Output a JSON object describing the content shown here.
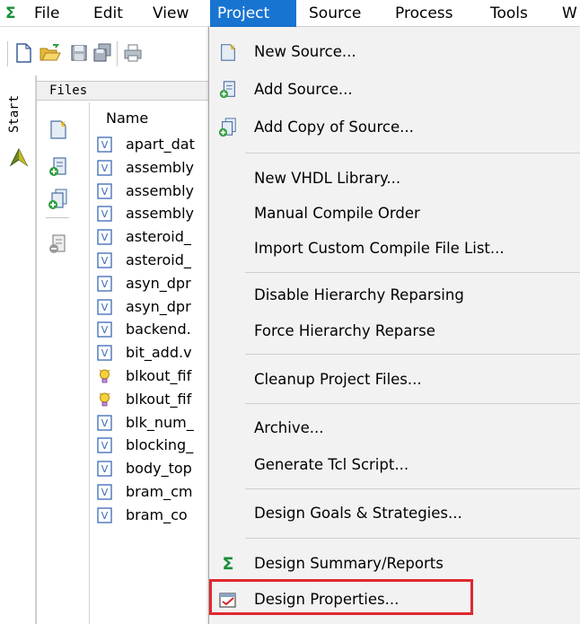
{
  "menubar": {
    "items": [
      {
        "label": "File"
      },
      {
        "label": "Edit"
      },
      {
        "label": "View"
      },
      {
        "label": "Project"
      },
      {
        "label": "Source"
      },
      {
        "label": "Process"
      },
      {
        "label": "Tools"
      },
      {
        "label": "W"
      }
    ],
    "active_item": "Project",
    "logo_glyph": "Σ"
  },
  "toolbar": {
    "icons": [
      "new-file-icon",
      "open-folder-icon",
      "save-icon",
      "save-all-icon",
      "print-icon"
    ]
  },
  "start_panel": {
    "tab_label": "Start"
  },
  "files_panel": {
    "header": "Files",
    "column_header": "Name",
    "side_icons": [
      "new-source-icon",
      "add-source-icon",
      "add-copy-source-icon",
      "remove-icon"
    ],
    "files": [
      {
        "name": "apart_dat",
        "icon": "verilog-file-icon"
      },
      {
        "name": "assembly",
        "icon": "verilog-file-icon"
      },
      {
        "name": "assembly",
        "icon": "verilog-file-icon"
      },
      {
        "name": "assembly",
        "icon": "verilog-file-icon"
      },
      {
        "name": "asteroid_",
        "icon": "verilog-file-icon"
      },
      {
        "name": "asteroid_",
        "icon": "verilog-file-icon"
      },
      {
        "name": "asyn_dpr",
        "icon": "verilog-file-icon"
      },
      {
        "name": "asyn_dpr",
        "icon": "verilog-file-icon"
      },
      {
        "name": "backend.",
        "icon": "verilog-file-icon"
      },
      {
        "name": "bit_add.v",
        "icon": "verilog-file-icon"
      },
      {
        "name": "blkout_fif",
        "icon": "ip-core-icon"
      },
      {
        "name": "blkout_fif",
        "icon": "ip-core-icon"
      },
      {
        "name": "blk_num_",
        "icon": "verilog-file-icon"
      },
      {
        "name": "blocking_",
        "icon": "verilog-file-icon"
      },
      {
        "name": "body_top",
        "icon": "verilog-file-icon"
      },
      {
        "name": "bram_cm",
        "icon": "verilog-file-icon"
      },
      {
        "name": "bram_co",
        "icon": "verilog-file-icon"
      }
    ]
  },
  "project_menu": {
    "items": [
      {
        "label": "New Source...",
        "icon": "new-source-icon"
      },
      {
        "label": "Add Source...",
        "icon": "add-source-icon"
      },
      {
        "label": "Add Copy of Source...",
        "icon": "add-copy-source-icon"
      },
      {
        "label": "New VHDL Library...",
        "icon": ""
      },
      {
        "label": "Manual Compile Order",
        "icon": ""
      },
      {
        "label": "Import Custom Compile File List...",
        "icon": ""
      },
      {
        "label": "Disable Hierarchy Reparsing",
        "icon": ""
      },
      {
        "label": "Force Hierarchy Reparse",
        "icon": ""
      },
      {
        "label": "Cleanup Project Files...",
        "icon": ""
      },
      {
        "label": "Archive...",
        "icon": ""
      },
      {
        "label": "Generate Tcl Script...",
        "icon": ""
      },
      {
        "label": "Design Goals & Strategies...",
        "icon": ""
      },
      {
        "label": "Design Summary/Reports",
        "icon": "design-summary-icon"
      },
      {
        "label": "Design Properties...",
        "icon": "design-properties-icon"
      }
    ],
    "highlighted_item": "Design Properties..."
  },
  "colors": {
    "menu_active_bg": "#1874d1",
    "highlight_border": "#e0282f",
    "dropdown_bg": "#f2f2f2",
    "logo_green": "#1a8f3a"
  }
}
